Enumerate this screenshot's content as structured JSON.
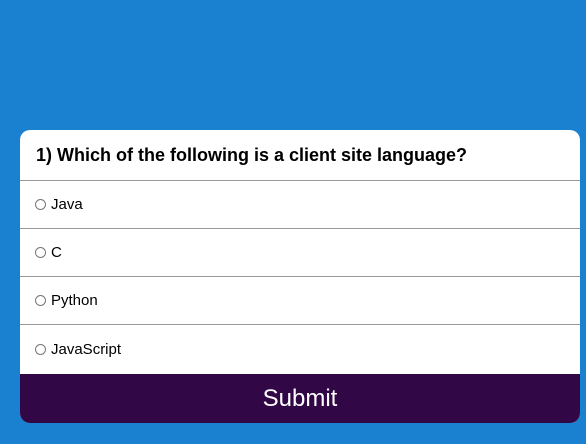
{
  "colors": {
    "background": "#1a80d0",
    "submit_bg": "#310746"
  },
  "quiz": {
    "question": "1) Which of the following is a client site language?",
    "options": [
      {
        "label": "Java",
        "selected": false
      },
      {
        "label": "C",
        "selected": false
      },
      {
        "label": "Python",
        "selected": false
      },
      {
        "label": "JavaScript",
        "selected": false
      }
    ],
    "submit_label": "Submit"
  }
}
